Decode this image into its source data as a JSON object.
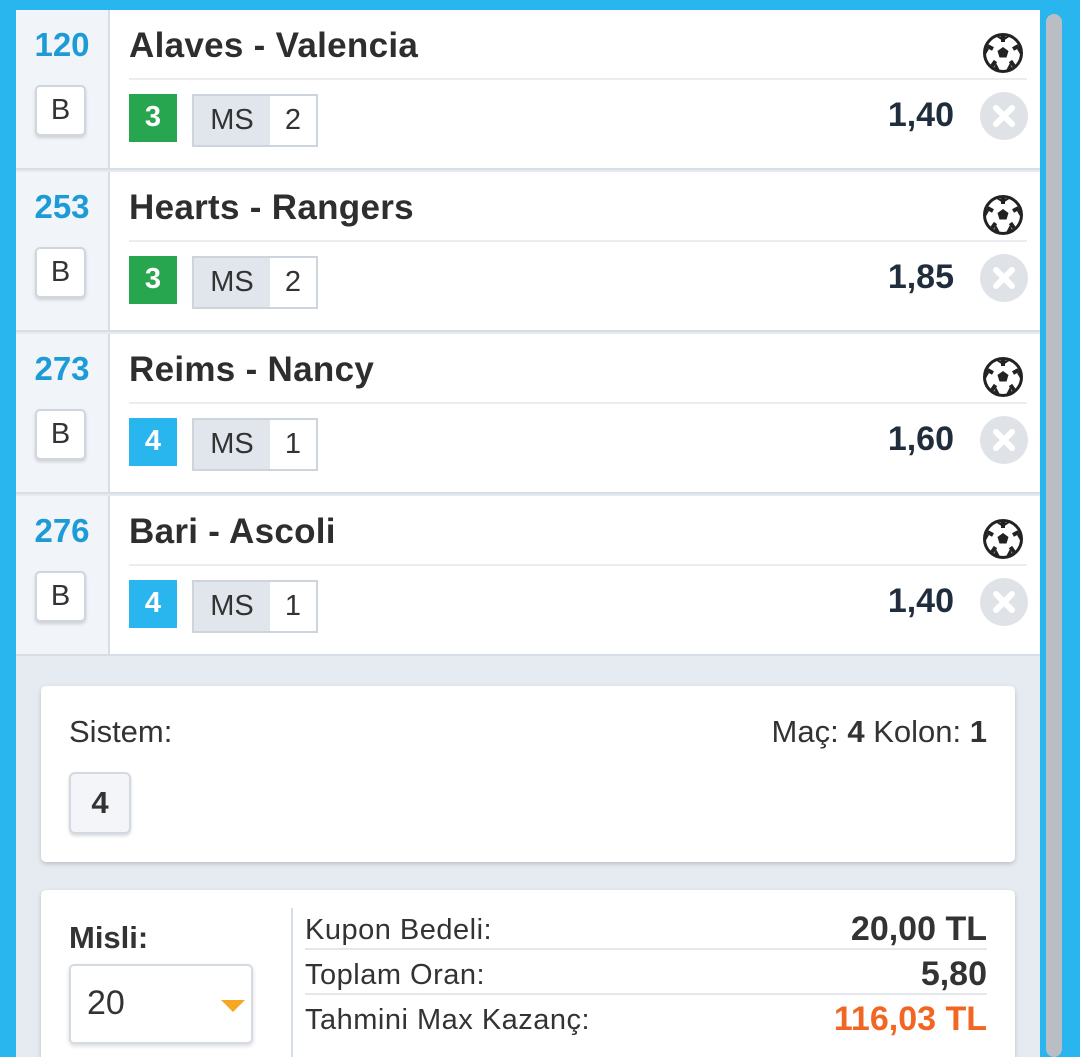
{
  "matches": [
    {
      "code": "120",
      "b_label": "B",
      "teams": "Alaves - Valencia",
      "badge": "3",
      "badge_color": "#27a54f",
      "bet_type": "MS",
      "pick": "2",
      "odd": "1,40",
      "sport_icon": "soccer-ball-icon",
      "remove_icon": "close-icon"
    },
    {
      "code": "253",
      "b_label": "B",
      "teams": "Hearts - Rangers",
      "badge": "3",
      "badge_color": "#27a54f",
      "bet_type": "MS",
      "pick": "2",
      "odd": "1,85",
      "sport_icon": "soccer-ball-icon",
      "remove_icon": "close-icon"
    },
    {
      "code": "273",
      "b_label": "B",
      "teams": "Reims - Nancy",
      "badge": "4",
      "badge_color": "#29b6ee",
      "bet_type": "MS",
      "pick": "1",
      "odd": "1,60",
      "sport_icon": "soccer-ball-icon",
      "remove_icon": "close-icon"
    },
    {
      "code": "276",
      "b_label": "B",
      "teams": "Bari - Ascoli",
      "badge": "4",
      "badge_color": "#29b6ee",
      "bet_type": "MS",
      "pick": "1",
      "odd": "1,40",
      "sport_icon": "soccer-ball-icon",
      "remove_icon": "close-icon"
    }
  ],
  "sistem": {
    "label": "Sistem:",
    "mac_label": "Maç:",
    "mac_value": "4",
    "kolon_label": "Kolon:",
    "kolon_value": "1",
    "option": "4"
  },
  "misli": {
    "label": "Misli:",
    "value": "20"
  },
  "summary": {
    "kupon_label": "Kupon Bedeli:",
    "kupon_value": "20,00 TL",
    "oran_label": "Toplam Oran:",
    "oran_value": "5,80",
    "kazanc_label": "Tahmini Max Kazanç:",
    "kazanc_value": "116,03 TL",
    "kazanc_color": "#f26522"
  },
  "colors": {
    "accent": "#29b6ee",
    "code_blue": "#1d9bd6",
    "green": "#27a54f"
  }
}
